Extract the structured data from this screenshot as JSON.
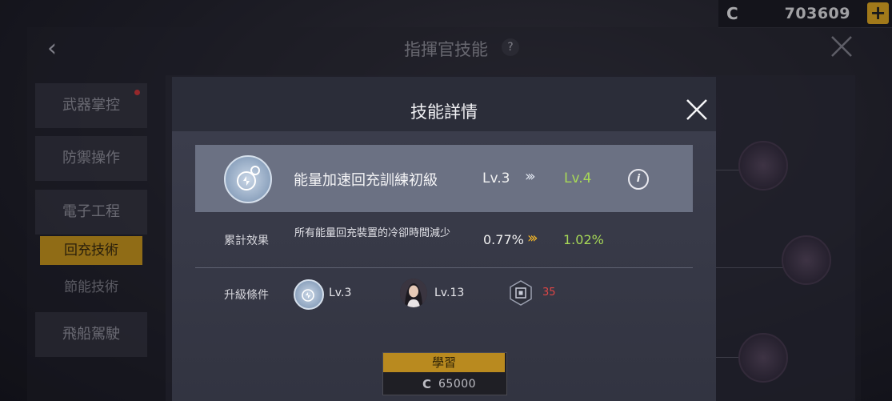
{
  "currency": {
    "symbol": "C",
    "amount": "703609",
    "add_label": "+"
  },
  "header": {
    "back": "‹",
    "title": "指揮官技能",
    "help": "?"
  },
  "categories": [
    {
      "label": "武器掌控"
    },
    {
      "label": "防禦操作"
    },
    {
      "label": "電子工程"
    },
    {
      "label": "回充技術"
    },
    {
      "label": "節能技術"
    },
    {
      "label": "飛船駕駛"
    }
  ],
  "modal": {
    "title": "技能詳情",
    "skill": {
      "name": "能量加速回充訓練初級",
      "level_from": "Lv.3",
      "arrow": "›››",
      "level_to": "Lv.4",
      "info": "i"
    },
    "effect": {
      "label": "累計效果",
      "description": "所有能量回充裝置的冷卻時間減少",
      "value_from": "0.77%",
      "arrow": "›››",
      "value_to": "1.02%"
    },
    "requirements": {
      "label": "升級條件",
      "skill_level": "Lv.3",
      "commander_level": "Lv.13",
      "item_count": "35"
    },
    "learn": {
      "label": "學習",
      "currency": "C",
      "cost": "65000"
    }
  },
  "colors": {
    "accent_gold": "#d9a21a",
    "level_up_green": "#a7d857",
    "insufficient_red": "#e04646",
    "arrow_gold": "#f1b529"
  }
}
